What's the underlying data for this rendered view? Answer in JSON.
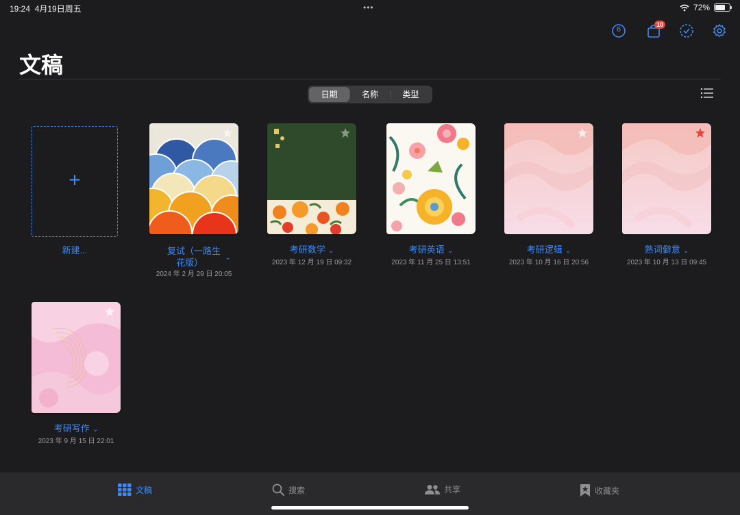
{
  "status": {
    "time": "19:24",
    "date": "4月19日周五",
    "battery": "72%",
    "battery_level": 0.72
  },
  "header": {
    "title": "文稿",
    "notif_badge": "10",
    "timer_value": "6"
  },
  "sort": {
    "options": [
      "日期",
      "名称",
      "类型"
    ],
    "selected": "日期"
  },
  "new_doc": {
    "label": "新建..."
  },
  "documents": [
    {
      "title_line1": "复试（一路生",
      "title_line2": "花版）",
      "date": "2024 年 2 月 29 日 20:05",
      "starred": false
    },
    {
      "title": "考研数学",
      "date": "2023 年 12 月 19 日 09:32",
      "starred": false
    },
    {
      "title": "考研英语",
      "date": "2023 年 11 月 25 日 13:51",
      "starred": false
    },
    {
      "title": "考研逻辑",
      "date": "2023 年 10 月 16 日 20:56",
      "starred": false
    },
    {
      "title": "熟词僻意",
      "date": "2023 年 10 月 13 日 09:45",
      "starred": true
    },
    {
      "title": "考研写作",
      "date": "2023 年 9 月 15 日 22:01",
      "starred": false
    }
  ],
  "tabs": [
    {
      "label": "文稿",
      "icon": "grid-icon",
      "active": true
    },
    {
      "label": "搜索",
      "icon": "search-icon",
      "active": false
    },
    {
      "label": "共享",
      "icon": "people-icon",
      "active": false
    },
    {
      "label": "收藏夹",
      "icon": "bookmark-star-icon",
      "active": false
    }
  ],
  "colors": {
    "accent": "#3d8af7",
    "background": "#1c1c1e",
    "badge": "#e5453a",
    "star_active": "#e5453a"
  }
}
